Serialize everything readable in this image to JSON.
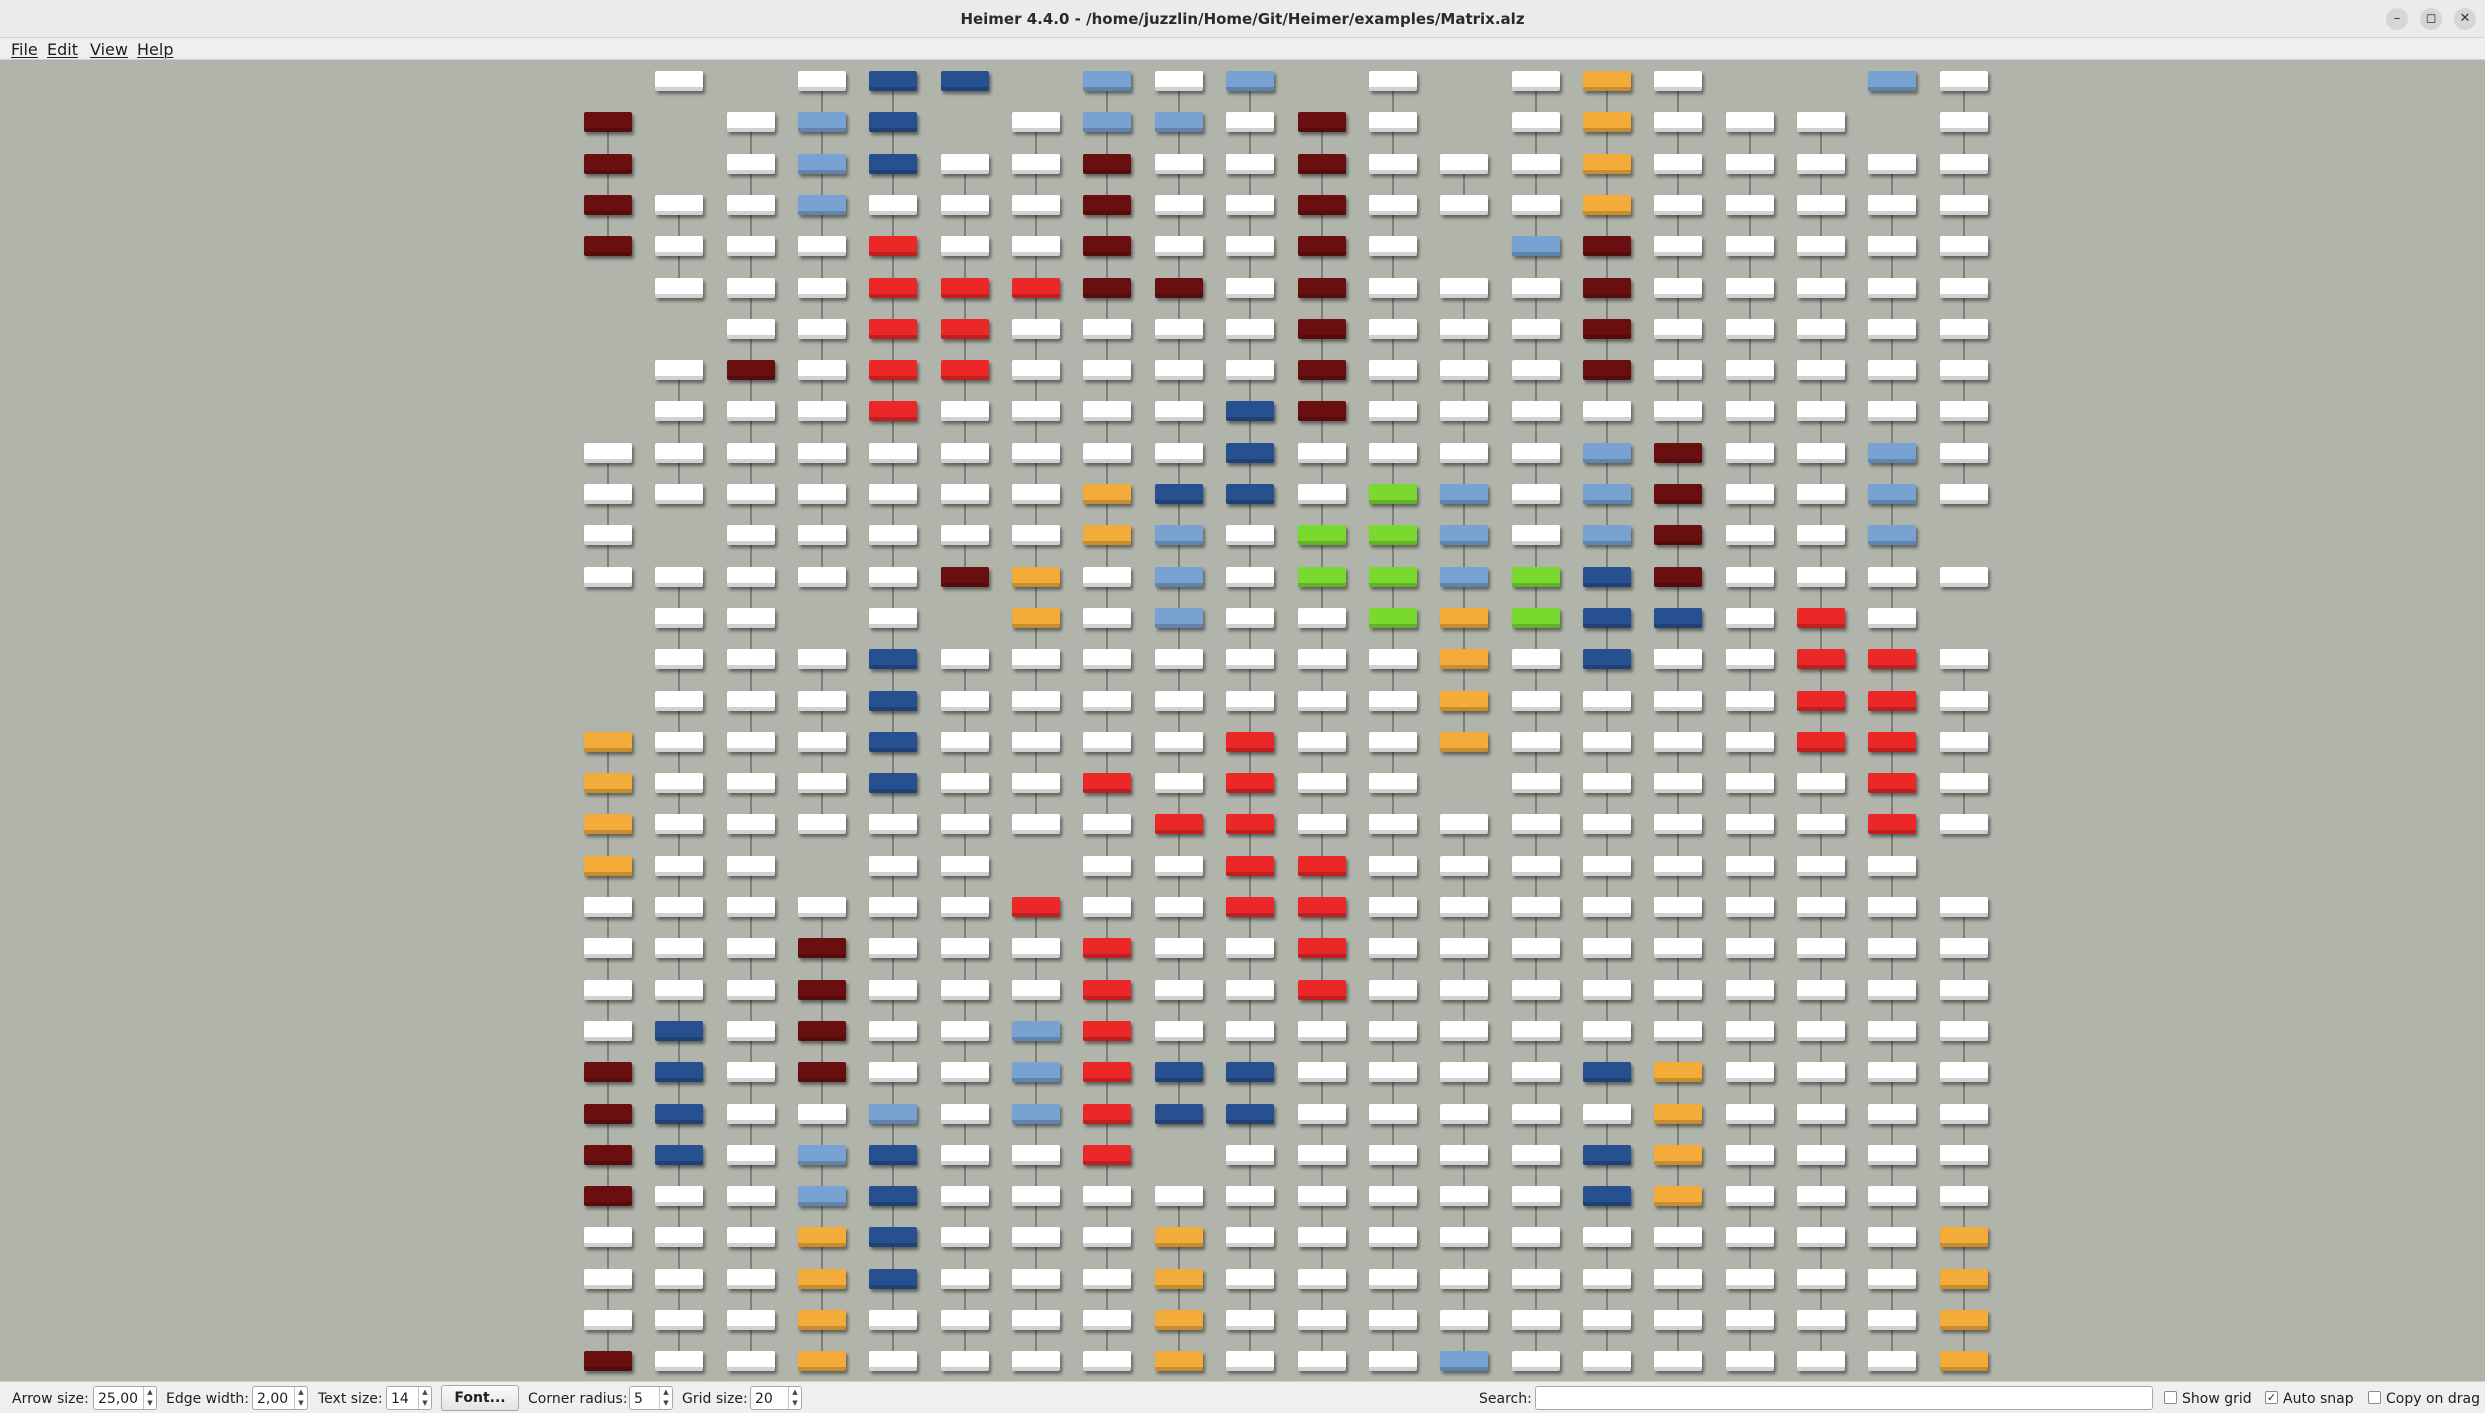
{
  "window": {
    "title": "Heimer 4.4.0 - /home/juzzlin/Home/Git/Heimer/examples/Matrix.alz",
    "minimize_glyph": "–",
    "maximize_glyph": "◻",
    "close_glyph": "✕"
  },
  "menu": {
    "file": "File",
    "edit": "Edit",
    "view": "View",
    "help": "Help"
  },
  "colors": {
    "background": "#b0b4ab",
    "edge": "#4a4a4a",
    "W": "#ffffff",
    "L": "#77a2d2",
    "N": "#26508f",
    "R": "#eb2727",
    "D": "#6a0f0f",
    "O": "#f3ac3a",
    "G": "#7ad92e"
  },
  "matrix": {
    "rows": [
      "_W_WNN_LWL_W_WOW__LW",
      "D_WLN_WLLWDW_WOWWW_W",
      "D_WLNWWDWWDWWWOWWWWW",
      "DWWLWWWDWWDWWWOWWWWW",
      "DWWWRWWDWWDW_LDWWWWW",
      "_WWWRRRDDWDWWWDWWWWW",
      "__WWRRWWWWDWWWDWWWWW",
      "_WDWRRWWWWDWWWDWWWWW",
      "_WWWRWWWWNDWWWWWWWWW",
      "WWWWWWWWWNWWWWLDWWLW",
      "WWWWWWWONNWGLWLDWWLW",
      "W_WWWWWOLWGGLWLDWWL_",
      "WWWWWDOWLWGGLGNDWWWW",
      "_WW_W_OWLWWGOGNNWRW_",
      "_WWWNWWWWWWWOWNWWRRW",
      "_WWWNWWWWWWWOWWWWRRW",
      "OWWWNWWWWRWWOWWWWRRW",
      "OWWWNWWRWRWW_WWWWWRW",
      "OWWWWWWWRRWWWWWWWWRW",
      "OWW_WW_WWRRWWWWWWWW_",
      "WWWWWWRWWRRWWWWWWWWW",
      "WWWDWWWRWWRWWWWWWWWW",
      "WWWDWWWRWWRWWWWWWWWW",
      "WNWDWWLRWWWWWWWWWWWW",
      "DNWDWWLRNNWWWWNOWWWW",
      "DNWWLWLRNNWWWWWOWWWW",
      "DNWLNWWR_WWWWWNOWWWW",
      "DWWLNWWWWWWWWWNOWWWW",
      "WWWONWWWOWWWWWWWWWWO",
      "WWWONWWWOWWWWWWWWWWO",
      "WWWOWWWWOWWWWWWWWWWO",
      "DWWOWWWWOWWWLWWWWWWO"
    ]
  },
  "toolbar": {
    "arrow_size_label": "Arrow size:",
    "arrow_size_value": "25,00",
    "edge_width_label": "Edge width:",
    "edge_width_value": "2,00",
    "text_size_label": "Text size:",
    "text_size_value": "14",
    "font_button": "Font...",
    "corner_radius_label": "Corner radius:",
    "corner_radius_value": "5",
    "grid_size_label": "Grid size:",
    "grid_size_value": "20",
    "search_label": "Search:",
    "search_value": "",
    "show_grid_label": "Show grid",
    "show_grid_checked": false,
    "auto_snap_label": "Auto snap",
    "auto_snap_checked": true,
    "copy_on_drag_label": "Copy on drag",
    "copy_on_drag_checked": false
  }
}
